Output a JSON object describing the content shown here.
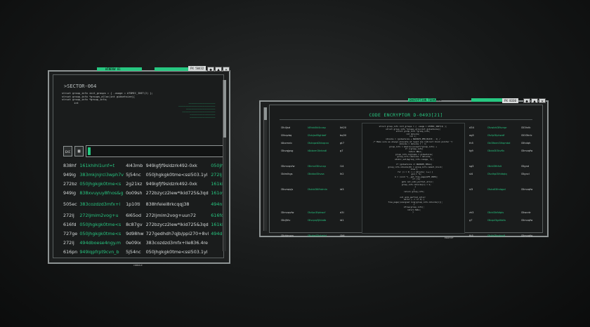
{
  "colors": {
    "accent": "#27c781",
    "frame": "#8e9494",
    "panel": "#1d1f1f"
  },
  "window1": {
    "tab_label": "WINDOW 01",
    "code_box": "PX 50432",
    "buttons": [
      "◆",
      "▲",
      "✕"
    ],
    "sector_title": ">SECTOR-064",
    "code_lines": "struct group_info init_groups = { .usage = ATOMIC_INIT(2) };\nstruct group_info *groups_alloc(int gidsetsize){\nstruct group_info *group_info;\n        int",
    "side_notes": "~~~~~~~~~~~~~~~~~~~~~\n~~~~~~~~~~~~~~~~~~~~~~~~~~~~~\n~~~~~~~~~~~~~~~~~~~~~~~\n~~~~~~~~~~~~~~~~~~~~~~~~~~\n~~~~~~~~~~~~~~~~~~~~\n~~~~~~~~~~~~~~~~~~~~",
    "icon_label": "EXC",
    "rows": [
      [
        "838hf",
        "161khihl1unf=t",
        "4l43mb",
        "949igfjf9sldzrk492-0xk",
        "050jh"
      ],
      [
        "949ig",
        "383mkjnjrcl3wph7v",
        "5j54nc",
        "050jhgkgk0tme<ssl503.1yl",
        "272lj"
      ],
      [
        "272bz",
        "050jhgkgk0tme<s",
        "2g21kz",
        "949igfjf9sldzrk492-0xk",
        "161ki"
      ],
      [
        "949ig",
        "838xvuyuy8fnos&g",
        "0o09sh",
        "272bzycz2lew*lkid725&3qd",
        "161oy"
      ],
      [
        "505ec",
        "383cozdzd3mfx+l",
        "1p10ti",
        "838hfeiei8rkcqqj38",
        "494nl"
      ],
      [
        "272lj",
        "272ljmim2vog+u",
        "6l65od",
        "272ljmim2vog+uun72",
        "616fd"
      ],
      [
        "616fd",
        "050jhgkgk0tme<s",
        "8c87gv",
        "272bzycz2lew*lkid725&3qd",
        "161ki"
      ],
      [
        "727ge",
        "050jhgkgk0tme<s",
        "9d98hw",
        "727gedhdh7qjb/ppi270+8vl",
        "494db"
      ],
      [
        "272lj",
        "494dboese4ngy.m",
        "0e09ix",
        "383cozdzd3mfx+lle836.4re",
        ""
      ],
      [
        "616pn",
        "949iqpfrpt9cvn_b",
        "5j54nc",
        "050jhgkgk0tme<ssl503.1yl",
        ""
      ]
    ],
    "bottom_label": "CONSOLE"
  },
  "window2": {
    "tab_label": "ENCRYPTION TERMINAL",
    "code_box": "PX 8330",
    "buttons": [
      "◆",
      "▲",
      "✕"
    ],
    "title": "CODE ENCRYPTOR D-0493[21]",
    "left_rows": [
      [
        "l3h4jsd",
        "l49cb0kl4cvsp",
        "lkt20"
      ],
      [
        "l2lkqvbq",
        "l2vbjsd3lghbef",
        "bq30"
      ],
      [
        "l4bcmnb",
        "l3vkqwd2kbqcvx",
        "gt7"
      ],
      [
        "l3bvqjpsg",
        "l4bbvm3krbndl",
        "g7"
      ],
      [
        "",
        "",
        ""
      ],
      [
        "l3kmvqvfw",
        "l3kmvl3lkvcxp",
        "l14"
      ],
      [
        "l3dmlhgs",
        "l3bkbvl3kvsa",
        "lh2"
      ],
      [
        "",
        "",
        ""
      ],
      [
        "l3bvnqvjs",
        "l3vkbl3Kfhdmln",
        "id3"
      ],
      [
        "",
        "",
        ""
      ],
      [
        "",
        "",
        ""
      ],
      [
        "l3lmvqvfw",
        "l3vfpv3fphwcf",
        "d3l"
      ],
      [
        "l3bljfrlv",
        "l3lvqvq3jlkbdb",
        "id1"
      ],
      [
        "",
        "",
        ""
      ],
      [
        "l3bhtmwn",
        "l3hdwjl3lvtmlvl",
        "l3i6"
      ]
    ],
    "right_rows": [
      [
        "d34",
        "l3vwbhl3fkvnpr",
        "l3l3hrlk"
      ],
      [
        "ag5",
        "l3vfpl3lphwdf",
        "l30l3hrlc"
      ],
      [
        "th5",
        "l3d3fwml3lhqmbd",
        "l3lhdqh"
      ],
      [
        "fg9",
        "l3bkd3l3kvflv",
        "l3lmvqfw"
      ],
      [
        "",
        "",
        ""
      ],
      [
        "sg3",
        "l3bhl3fkfslt",
        "l3lgnd"
      ],
      [
        "sl4",
        "l3vdhpl3lhldqlq",
        "l3lgncl"
      ],
      [
        "",
        "",
        ""
      ],
      [
        "sl3",
        "l3vbdl3lhdqpd",
        "l3lmvqfw"
      ],
      [
        "",
        "",
        ""
      ],
      [
        "",
        "",
        ""
      ],
      [
        "zh3",
        "l3bhl3kfbfpls",
        "l3lwnrtr"
      ],
      [
        "g7",
        "l3bqvl3gdhbfa",
        "l3lmvqfw"
      ],
      [
        "",
        "",
        ""
      ],
      [
        "fh5",
        "l3vfpl3bphpdf",
        "l3lmvqfw"
      ]
    ],
    "center_text": "struct group_info init_groups = { .usage = ATOMIC_INIT(2) };\nstruct group_info *groups_alloc(int gidsetsize){\nstruct group_info *group_info;\nint nblocks;\nint i;\nnblocks = (gidsetsize + NGROUPS_PER_BLOCK - 1) /\n/* Make sure we always allocate at least one indirect block pointer */\nnblocks = nblocks ? : 1;\ngroup_info = kmalloc(sizeof(*group_info) +\n  if (!group_info)\n    return NULL;\n  group_info->ngroups = gidsetsize;\n  group_info->nblocks = nblocks;\n  atomic_set(&group_info->usage, 1);\n\n  if (gidsetsize <= NGROUPS_SMALL)\n    group_info->blocks[0] = group_info->small_block;\n  else {\n    for (i = 0; i < nblocks; i++) {\n      gid_t *b;\n      b = (void *)__get_free_page(GFP_USER);\n      if (!b)\n        goto out_undo_partial_alloc;\n      group_info->blocks[i] = b;\n    }\n  }\n  return group_info;\n\nout_undo_partial_alloc:\n  while (--i >= 0) {\n    free_page((unsigned long)group_info->blocks[i]);\n  }\n  kfree(group_info);\n  return NULL;\n}",
    "bottom_label": "ENCRYPT"
  }
}
